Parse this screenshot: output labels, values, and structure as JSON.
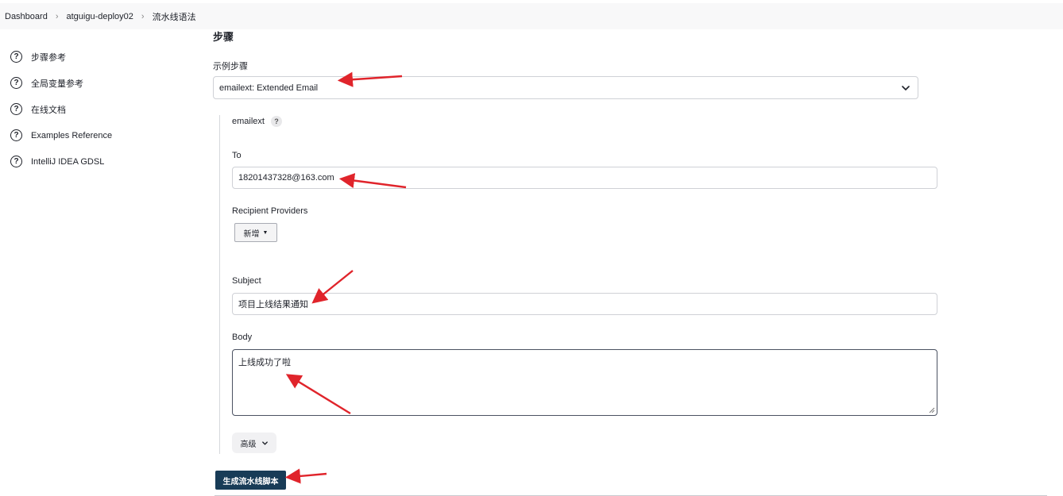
{
  "breadcrumb": {
    "items": [
      "Dashboard",
      "atguigu-deploy02",
      "流水线语法"
    ]
  },
  "sidebar": {
    "items": [
      {
        "label": "步骤参考"
      },
      {
        "label": "全局变量参考"
      },
      {
        "label": "在线文档"
      },
      {
        "label": "Examples Reference"
      },
      {
        "label": "IntelliJ IDEA GDSL"
      }
    ]
  },
  "main": {
    "section_title": "步骤",
    "sample_step_label": "示例步骤",
    "sample_step_value": "emailext: Extended Email",
    "step_name": "emailext",
    "help_glyph": "?",
    "to_label": "To",
    "to_value": "18201437328@163.com",
    "recipient_providers_label": "Recipient Providers",
    "add_button_label": "新增",
    "subject_label": "Subject",
    "subject_value": "项目上线结果通知",
    "body_label": "Body",
    "body_value": "上线成功了啦",
    "advanced_label": "高级",
    "generate_button_label": "生成流水线脚本"
  },
  "colors": {
    "primary_button": "#183c57",
    "annotation_arrow": "#e0242b"
  },
  "icons": {
    "sidebar_item": "help-circle-icon",
    "breadcrumb_separator": "chevron-right-icon",
    "select_dropdown": "chevron-down-icon",
    "advanced_toggle": "chevron-down-icon",
    "add_dropdown": "caret-down-icon"
  }
}
